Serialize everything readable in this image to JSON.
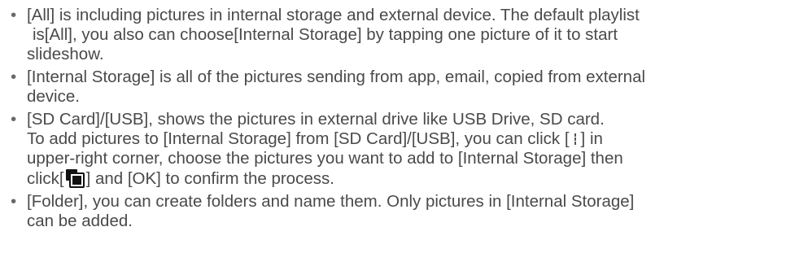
{
  "bullet_glyph": "•",
  "items": [
    {
      "segments": [
        "[All] is including pictures in internal storage and external device. The default playlist",
        "is[All], you also can choose[Internal Storage] by tapping one picture of it to start",
        "slideshow."
      ]
    },
    {
      "segments": [
        "[Internal Storage] is all of the pictures sending from app, email, copied from external",
        "device."
      ]
    },
    {
      "line1": "[SD Card]/[USB], shows the pictures in external drive like USB Drive, SD card.",
      "line2_before_icon": "To add pictures to [Internal Storage] from [SD Card]/[USB], you can click [",
      "line2_after_icon": "] in",
      "line3": "upper-right corner, choose the pictures you want to add to [Internal Storage] then",
      "line4_before_icon": "click[",
      "line4_after_icon": "] and [OK] to confirm the process."
    },
    {
      "segments": [
        "[Folder], you can create folders and name them. Only pictures in [Internal Storage]",
        "can be added."
      ]
    }
  ],
  "icons": {
    "more": "vertical-dots-icon",
    "copy": "copy-to-storage-icon"
  },
  "colors": {
    "text": "#4a4a4a",
    "icon": "#111111"
  }
}
